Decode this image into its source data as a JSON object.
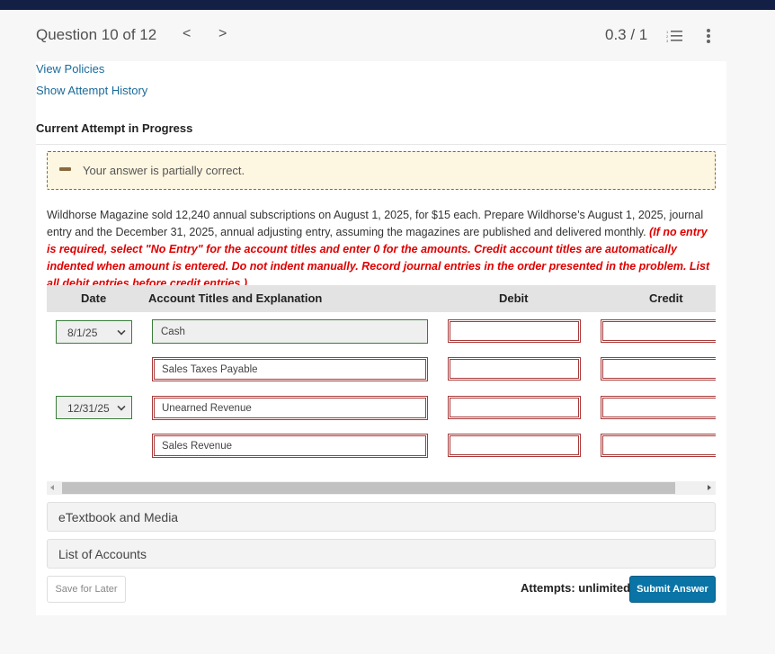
{
  "header": {
    "question_label": "Question 10 of 12",
    "prev_icon": "chevron-left-icon",
    "prev_glyph": "<",
    "next_icon": "chevron-right-icon",
    "next_glyph": ">",
    "score": "0.3 / 1",
    "list_icon": "numbered-list-icon",
    "more_icon": "more-vertical-icon"
  },
  "links": {
    "view_policies": "View Policies",
    "show_attempt_history": "Show Attempt History"
  },
  "attempt_heading": "Current Attempt in Progress",
  "feedback": {
    "icon": "partial-correct-minus-icon",
    "text": "Your answer is partially correct.",
    "color": "#8a6a3d"
  },
  "problem": {
    "text": "Wildhorse Magazine sold 12,240 annual subscriptions on August 1, 2025, for $15 each. Prepare Wildhorse’s August 1, 2025, journal entry and the December 31, 2025, annual adjusting entry, assuming the magazines are published and delivered monthly. ",
    "instructions": "(If no entry is required, select \"No Entry\" for the account titles and enter 0 for the amounts. Credit account titles are automatically indented when amount is entered. Do not indent manually. Record journal entries in the order presented in the problem. List all debit entries before credit entries.)"
  },
  "journal": {
    "columns": [
      "Date",
      "Account Titles and Explanation",
      "Debit",
      "Credit"
    ],
    "rows": [
      {
        "date": "8/1/25",
        "account": "Cash",
        "account_status": "correct",
        "debit": "",
        "credit": ""
      },
      {
        "date": "",
        "account": "Sales Taxes Payable",
        "account_status": "incorrect",
        "debit": "",
        "credit": ""
      },
      {
        "date": "12/31/25",
        "account": "Unearned Revenue",
        "account_status": "incorrect",
        "debit": "",
        "credit": ""
      },
      {
        "date": "",
        "account": "Sales Revenue",
        "account_status": "incorrect",
        "debit": "",
        "credit": ""
      }
    ]
  },
  "accordions": {
    "etextbook": "eTextbook and Media",
    "list_of_accounts": "List of Accounts"
  },
  "footer": {
    "save_label": "Save for Later",
    "attempts_label": "Attempts: unlimited",
    "submit_label": "Submit Answer"
  },
  "colors": {
    "topbar": "#141f45",
    "link": "#1a6b9a",
    "correct_border": "#3a7d3a",
    "incorrect_border": "#a83a3a",
    "submit": "#0a74a6",
    "instructions": "#e00000"
  }
}
